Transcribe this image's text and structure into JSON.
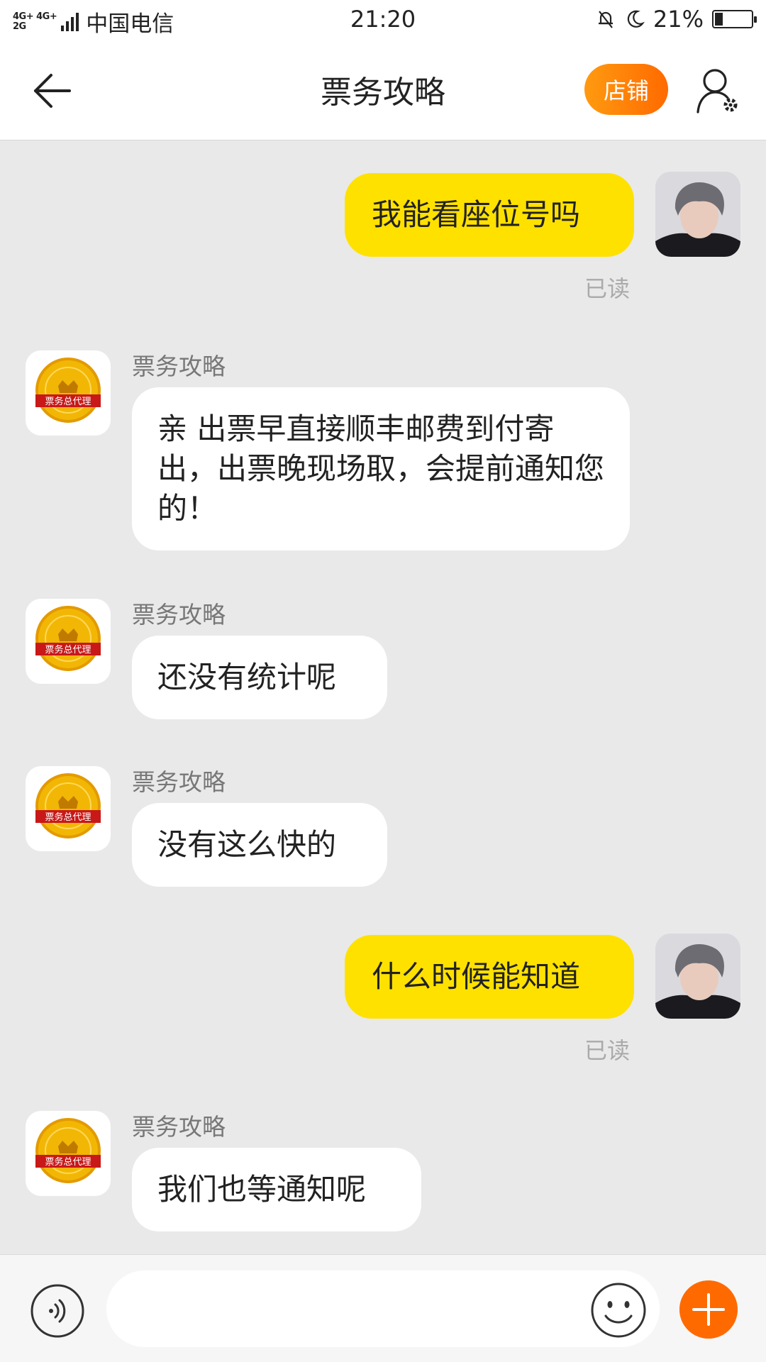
{
  "status_bar": {
    "network_top": "4G+ 4G+",
    "network_bottom": "2G",
    "carrier": "中国电信",
    "time": "21:20",
    "battery_text": "21%",
    "battery_level": 0.21
  },
  "header": {
    "title": "票务攻略",
    "shop_label": "店铺",
    "back_icon": "arrow-left-icon",
    "settings_icon": "user-settings-icon"
  },
  "messages": [
    {
      "side": "out",
      "text": "我能看座位号吗",
      "status": "已读"
    },
    {
      "side": "in",
      "sender": "票务攻略",
      "text": "亲 出票早直接顺丰邮费到付寄出，出票晚现场取，会提前通知您的！"
    },
    {
      "side": "in",
      "sender": "票务攻略",
      "text": "还没有统计呢"
    },
    {
      "side": "in",
      "sender": "票务攻略",
      "text": "没有这么快的"
    },
    {
      "side": "out",
      "text": "什么时候能知道",
      "status": "已读"
    },
    {
      "side": "in",
      "sender": "票务攻略",
      "text": "我们也等通知呢"
    }
  ],
  "shop_avatar_label": "票务总代理",
  "input_bar": {
    "voice_icon": "voice-icon",
    "emoji_icon": "emoji-icon",
    "plus_icon": "plus-icon",
    "placeholder": ""
  },
  "colors": {
    "outgoing_bubble": "#ffe100",
    "incoming_bubble": "#ffffff",
    "accent_orange": "#ff6a00",
    "chat_background": "#e9e9e9"
  }
}
